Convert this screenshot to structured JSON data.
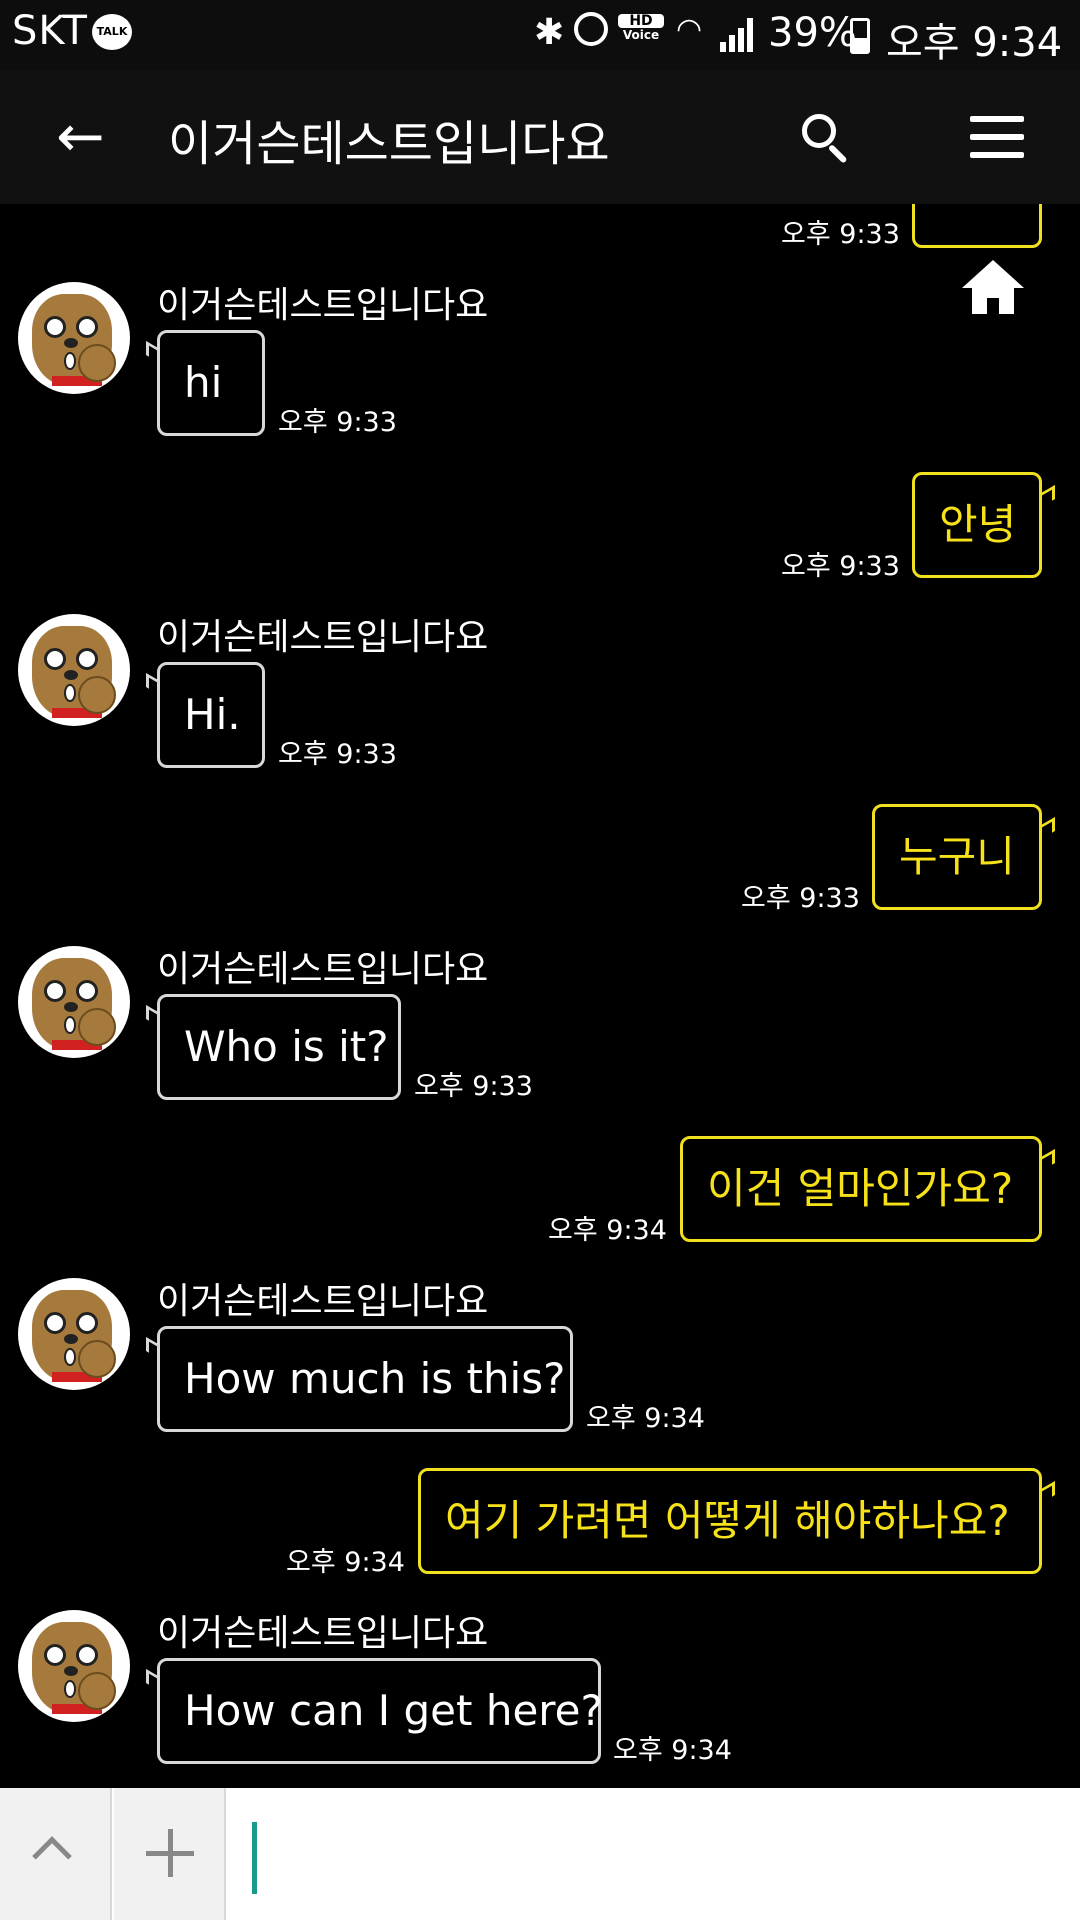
{
  "status_bar": {
    "carrier": "SKT",
    "talk_badge": "TALK",
    "hd_top": "HD",
    "hd_bottom": "Voice",
    "battery": "39%",
    "time": "오후 9:34",
    "icons": [
      "bluetooth-icon",
      "alarm-icon",
      "hd-voice-icon",
      "wifi-icon",
      "signal-icon",
      "battery-icon"
    ]
  },
  "header": {
    "title": "이거슨테스트입니다요",
    "back_icon": "arrow-left",
    "search_icon": "magnifier",
    "menu_icon": "hamburger"
  },
  "messages": [
    {
      "direction": "out",
      "text": "",
      "time": "오후 9:33",
      "partial": true
    },
    {
      "direction": "in",
      "sender": "이거슨테스트입니다요",
      "text": "hi",
      "time": "오후 9:33"
    },
    {
      "direction": "out",
      "text": "안녕",
      "time": "오후 9:33"
    },
    {
      "direction": "in",
      "sender": "이거슨테스트입니다요",
      "text": "Hi.",
      "time": "오후 9:33"
    },
    {
      "direction": "out",
      "text": "누구니",
      "time": "오후 9:33"
    },
    {
      "direction": "in",
      "sender": "이거슨테스트입니다요",
      "text": "Who is it?",
      "time": "오후 9:33"
    },
    {
      "direction": "out",
      "text": "이건 얼마인가요?",
      "time": "오후 9:34"
    },
    {
      "direction": "in",
      "sender": "이거슨테스트입니다요",
      "text": "How much is this?",
      "time": "오후 9:34"
    },
    {
      "direction": "out",
      "text": "여기 가려면 어떻게 해야하나요?",
      "time": "오후 9:34"
    },
    {
      "direction": "in",
      "sender": "이거슨테스트입니다요",
      "text": "How can I get here?",
      "time": "오후 9:34"
    }
  ],
  "input_bar": {
    "value": "",
    "expand_icon": "chevron-up",
    "attach_icon": "plus"
  },
  "colors": {
    "background": "#000000",
    "outgoing_bubble": "#f7e21a",
    "incoming_bubble": "#d8d8d8",
    "cursor": "#1a9a8a"
  }
}
